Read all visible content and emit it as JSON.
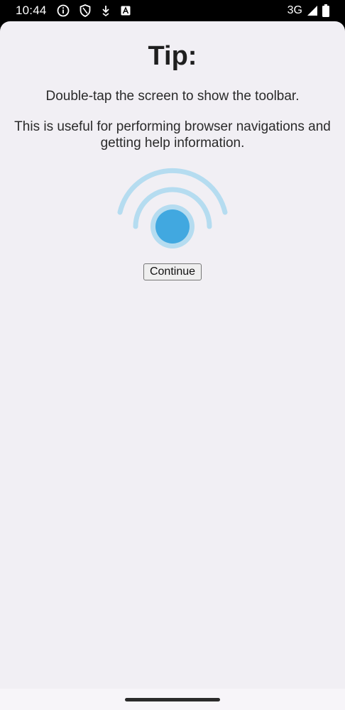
{
  "status_bar": {
    "time": "10:44",
    "network": "3G",
    "left_icons": [
      "info-icon",
      "shield-icon",
      "download-icon",
      "font-icon"
    ],
    "right_icons": [
      "signal-icon",
      "battery-icon"
    ]
  },
  "tip": {
    "title": "Tip:",
    "line1": "Double-tap the screen to show the toolbar.",
    "line2": "This is useful for performing browser navigations and getting help information.",
    "illustration": "double-tap-icon",
    "accent_color": "#41a8e0",
    "arc_color": "#b5dcf0",
    "button_label": "Continue"
  },
  "colors": {
    "background": "#f1eff4",
    "status_bar": "#000000"
  }
}
